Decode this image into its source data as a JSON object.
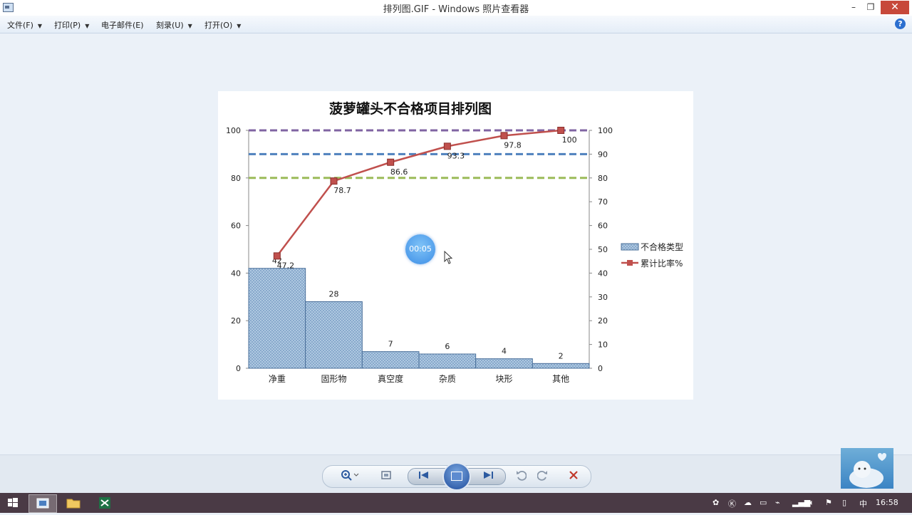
{
  "window": {
    "title": "排列图.GIF - Windows 照片查看器",
    "min": "–",
    "max": "❐",
    "close": "✕"
  },
  "menu": {
    "items": [
      {
        "label": "文件(F)",
        "caret": true
      },
      {
        "label": "打印(P)",
        "caret": true
      },
      {
        "label": "电子邮件(E)",
        "caret": false
      },
      {
        "label": "刻录(U)",
        "caret": true
      },
      {
        "label": "打开(O)",
        "caret": true
      }
    ],
    "help": "?"
  },
  "chart_data": {
    "type": "bar",
    "title": "菠萝罐头不合格项目排列图",
    "categories": [
      "净重",
      "固形物",
      "真空度",
      "杂质",
      "块形",
      "其他"
    ],
    "series": [
      {
        "name": "不合格类型",
        "type": "bar",
        "values": [
          42,
          28,
          7,
          6,
          4,
          2
        ],
        "color": "#9ab9d8"
      },
      {
        "name": "累计比率%",
        "type": "line",
        "values": [
          47.2,
          78.7,
          86.6,
          93.3,
          97.8,
          100
        ],
        "color": "#c0504d"
      }
    ],
    "line_labels": [
      "47.2",
      "78.7",
      "86.6",
      "93.3",
      "97.8",
      "100"
    ],
    "reference_lines": [
      {
        "value": 100,
        "color": "#8064a2"
      },
      {
        "value": 90,
        "color": "#4f81bd"
      },
      {
        "value": 80,
        "color": "#9bbb59"
      }
    ],
    "y_left": {
      "min": 0,
      "max": 100,
      "ticks": [
        "0",
        "20",
        "40",
        "60",
        "80",
        "100"
      ]
    },
    "y_right": {
      "min": 0,
      "max": 100,
      "ticks": [
        "0",
        "10",
        "20",
        "30",
        "40",
        "50",
        "60",
        "70",
        "80",
        "90",
        "100"
      ]
    },
    "legend": {
      "position": "right"
    }
  },
  "overlay": {
    "timer": "00:05"
  },
  "controls": {
    "zoom_icon": "magnifier-icon",
    "fit_icon": "fit-window-icon",
    "prev_icon": "previous-icon",
    "slideshow_icon": "slideshow-icon",
    "next_icon": "next-icon",
    "rotate_ccw_icon": "rotate-left-icon",
    "rotate_cw_icon": "rotate-right-icon",
    "delete_icon": "delete-icon",
    "delete_color": "#c0392b"
  },
  "taskbar": {
    "ime": "中",
    "clock": "16:58",
    "apps": [
      "windows-logo-icon",
      "photo-viewer-icon",
      "file-explorer-icon",
      "excel-icon"
    ]
  }
}
